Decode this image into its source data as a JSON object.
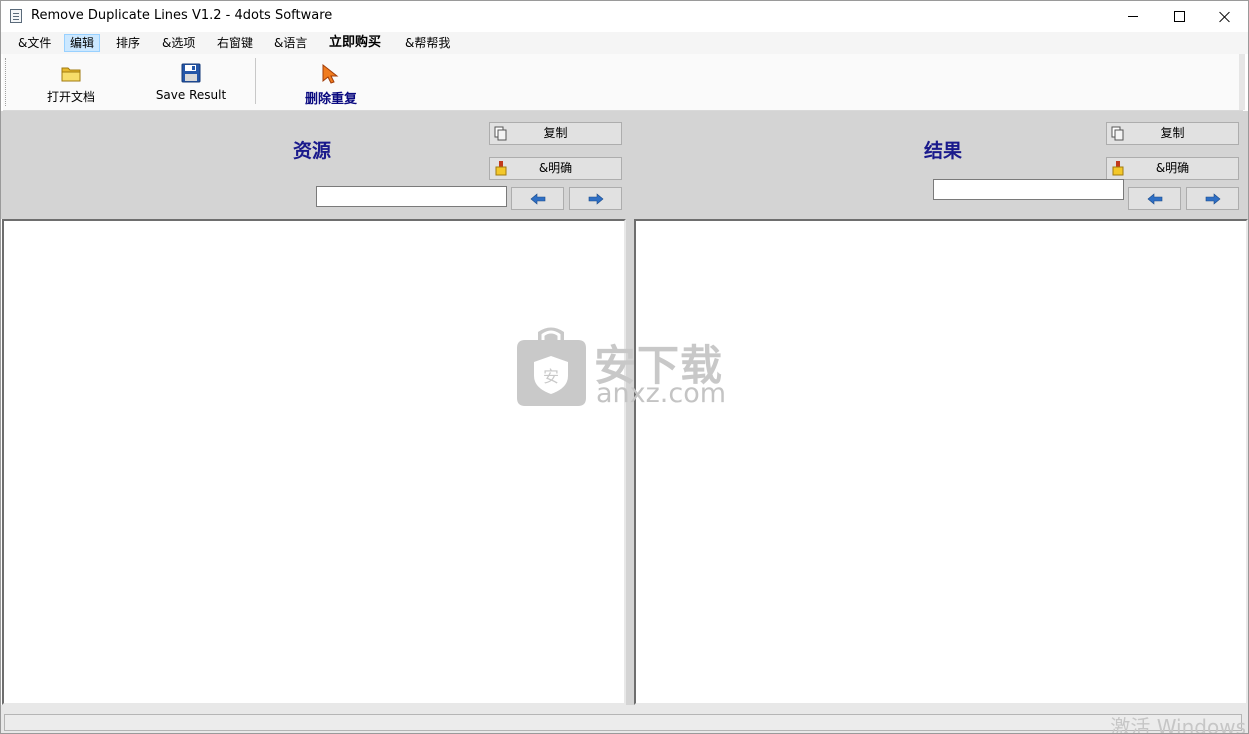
{
  "window": {
    "title": "Remove Duplicate Lines V1.2 - 4dots Software"
  },
  "menu": [
    "&文件",
    "编辑",
    "排序",
    "&选项",
    "右窗键",
    "&语言",
    "立即购买",
    "&帮帮我"
  ],
  "toolbar": {
    "open_label": "打开文档",
    "save_label": "Save Result",
    "remove_label": "删除重复"
  },
  "source_panel": {
    "title": "资源",
    "copy_label": "复制",
    "clear_label": "&明确",
    "search_value": ""
  },
  "result_panel": {
    "title": "结果",
    "copy_label": "复制",
    "clear_label": "&明确",
    "search_value": ""
  },
  "watermark": {
    "brand_cn": "安下载",
    "brand_en": "anxz.com",
    "shield_char": "安"
  },
  "status": {
    "activate_text": "激活 Windows"
  },
  "icons": {
    "app": "document-icon",
    "open": "folder-icon",
    "save": "floppy-disk-icon",
    "remove": "cursor-arrow-icon",
    "copy": "copy-icon",
    "clear": "eraser-icon",
    "prev": "arrow-left-icon",
    "next": "arrow-right-icon"
  },
  "colors": {
    "panel_title": "#1a1a8c",
    "header_bg": "#d4d4d4",
    "menu_active": "#cce8ff",
    "arrow_blue": "#2f6fc4"
  }
}
